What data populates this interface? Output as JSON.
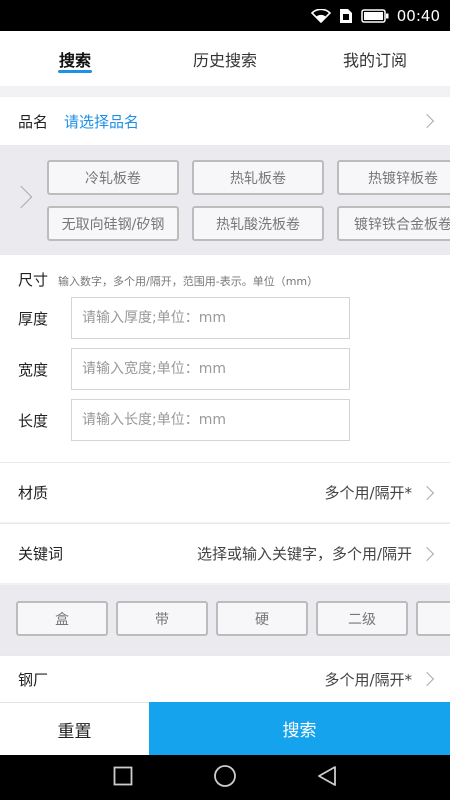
{
  "status_bar": {
    "time": "00:40"
  },
  "tabs": [
    {
      "label": "搜索",
      "active": true
    },
    {
      "label": "历史搜索",
      "active": false
    },
    {
      "label": "我的订阅",
      "active": false
    }
  ],
  "product_name": {
    "label": "品名",
    "placeholder": "请选择品名"
  },
  "product_chips": [
    "冷轧板卷",
    "热轧板卷",
    "热镀锌板卷",
    "无取向硅钢/矽钢",
    "热轧酸洗板卷",
    "镀锌铁合金板卷"
  ],
  "size": {
    "title": "尺寸",
    "hint": "输入数字，多个用/隔开，范围用-表示。单位（mm）",
    "thickness": {
      "label": "厚度",
      "placeholder": "请输入厚度;单位：mm"
    },
    "width": {
      "label": "宽度",
      "placeholder": "请输入宽度;单位：mm"
    },
    "length": {
      "label": "长度",
      "placeholder": "请输入长度;单位：mm"
    }
  },
  "material": {
    "label": "材质",
    "value": "多个用/隔开*"
  },
  "keyword": {
    "label": "关键词",
    "value": "选择或输入关键字，多个用/隔开"
  },
  "keyword_chips": [
    "盒",
    "带",
    "硬",
    "二级",
    ""
  ],
  "steel_mill": {
    "label": "钢厂",
    "value": "多个用/隔开*"
  },
  "actions": {
    "reset": "重置",
    "search": "搜索"
  },
  "colors": {
    "accent": "#16a3ee",
    "tab_indicator": "#1e90e6",
    "link": "#1e90e6"
  }
}
